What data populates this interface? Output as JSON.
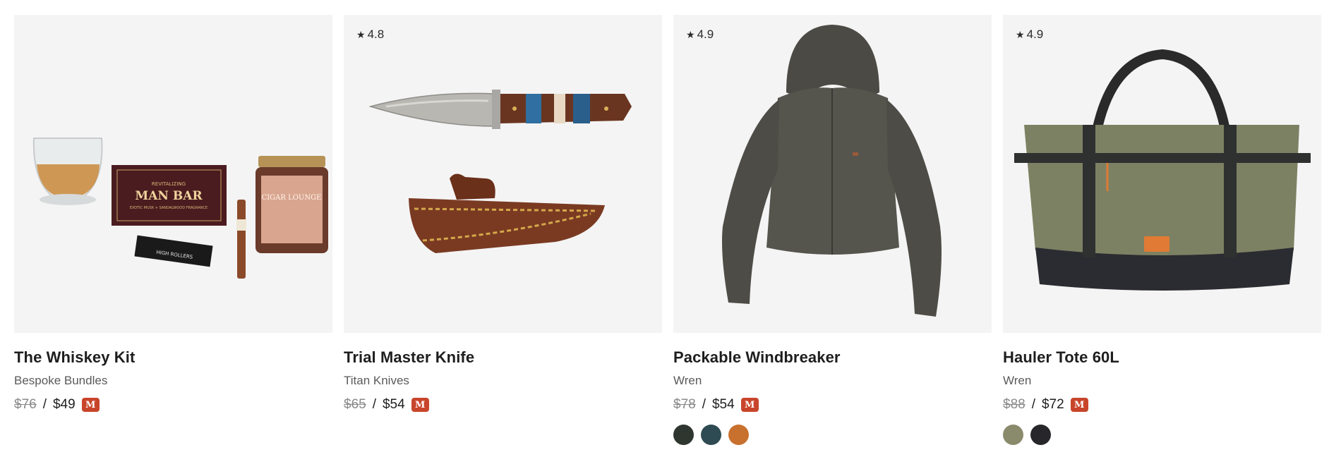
{
  "products": [
    {
      "title": "The Whiskey Kit",
      "brand": "Bespoke Bundles",
      "was_price": "$76",
      "price": "$49",
      "badge": "M",
      "rating": "",
      "image_texts": [
        "MAN BAR",
        "REVITALIZING",
        "EXOTIC MUSK + SANDALWOOD FRAGRANCE",
        "HIGH ROLLERS",
        "CIGAR LOUNGE"
      ]
    },
    {
      "title": "Trial Master Knife",
      "brand": "Titan Knives",
      "was_price": "$65",
      "price": "$54",
      "badge": "M",
      "rating": "4.8"
    },
    {
      "title": "Packable Windbreaker",
      "brand": "Wren",
      "was_price": "$78",
      "price": "$54",
      "badge": "M",
      "rating": "4.9",
      "swatches": [
        "#2f352f",
        "#2e4a52",
        "#c8702e"
      ]
    },
    {
      "title": "Hauler Tote 60L",
      "brand": "Wren",
      "was_price": "$88",
      "price": "$72",
      "badge": "M",
      "rating": "4.9",
      "swatches": [
        "#8a8a6c",
        "#26262b"
      ]
    }
  ],
  "colors": {
    "badge_bg": "#c8452b",
    "image_bg": "#f4f4f4"
  }
}
